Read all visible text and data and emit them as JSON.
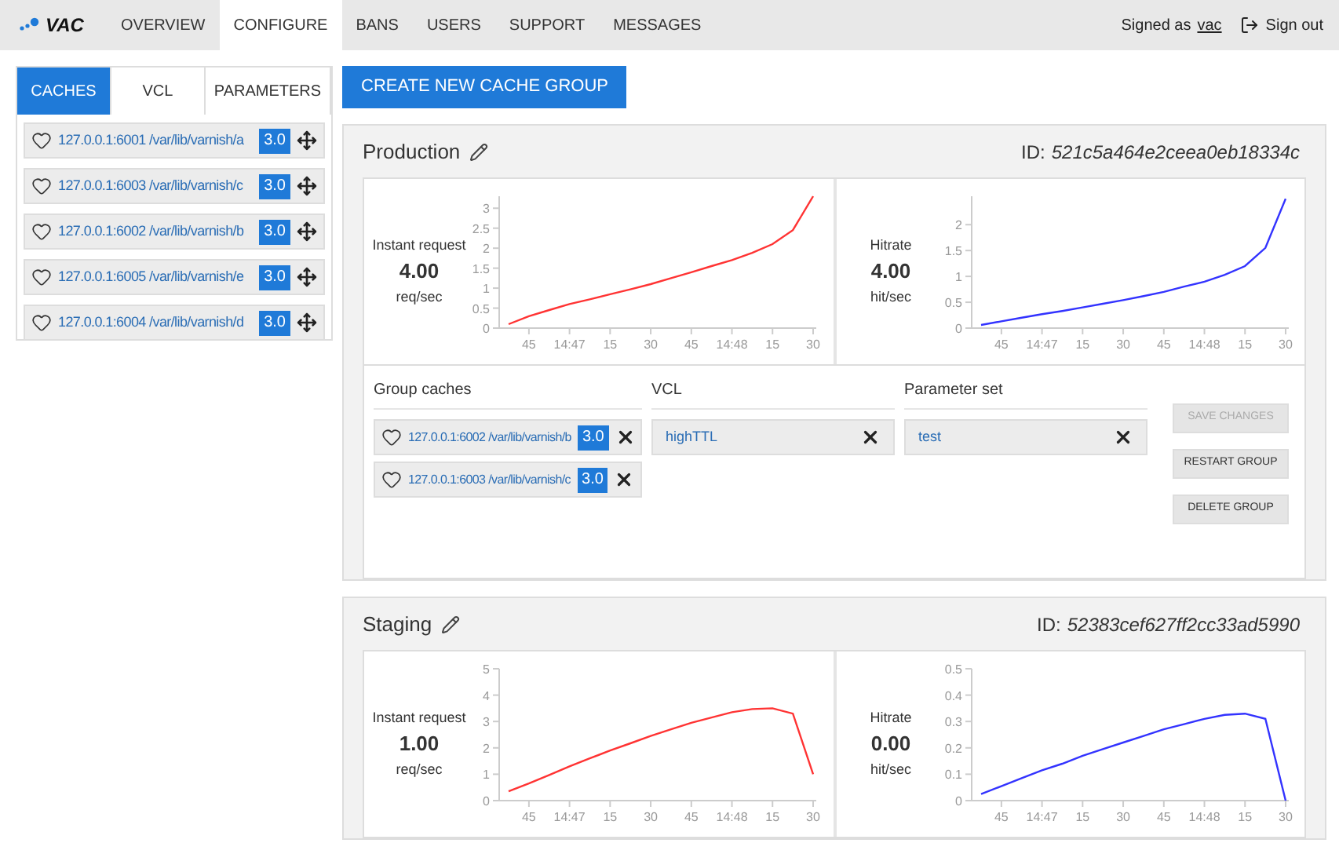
{
  "header": {
    "logo": "VAC",
    "nav": [
      {
        "label": "OVERVIEW",
        "selected": false
      },
      {
        "label": "CONFIGURE",
        "selected": true
      },
      {
        "label": "BANS",
        "selected": false
      },
      {
        "label": "USERS",
        "selected": false
      },
      {
        "label": "SUPPORT",
        "selected": false
      },
      {
        "label": "MESSAGES",
        "selected": false
      }
    ],
    "signed_as": "Signed as",
    "user": "vac",
    "sign_out": "Sign out"
  },
  "sidebar": {
    "tabs": [
      {
        "label": "CACHES",
        "selected": true
      },
      {
        "label": "VCL",
        "selected": false
      },
      {
        "label": "PARAMETERS",
        "selected": false
      }
    ],
    "caches": [
      {
        "address": "127.0.0.1:6001 /var/lib/varnish/a",
        "version": "3.0"
      },
      {
        "address": "127.0.0.1:6003 /var/lib/varnish/c",
        "version": "3.0"
      },
      {
        "address": "127.0.0.1:6002 /var/lib/varnish/b",
        "version": "3.0"
      },
      {
        "address": "127.0.0.1:6005 /var/lib/varnish/e",
        "version": "3.0"
      },
      {
        "address": "127.0.0.1:6004 /var/lib/varnish/d",
        "version": "3.0"
      }
    ]
  },
  "create_button": "CREATE NEW CACHE GROUP",
  "groups": [
    {
      "name": "Production",
      "id_label": "ID:",
      "id": "521c5a464e2ceea0eb18334c",
      "metrics": [
        {
          "label": "Instant request",
          "value": "4.00",
          "unit": "req/sec",
          "chart_data": {
            "type": "line",
            "ylim": [
              0,
              3.3
            ],
            "yticks": [
              0,
              0.5,
              1,
              1.5,
              2,
              2.5,
              3
            ],
            "categories": [
              null,
              "45",
              null,
              "14:47",
              null,
              "15",
              null,
              "30",
              null,
              "45",
              null,
              "14:48",
              null,
              "15",
              null,
              "30"
            ],
            "series": [
              {
                "color": "#ff3333",
                "values": [
                  0.1,
                  0.3,
                  0.45,
                  0.6,
                  0.72,
                  0.85,
                  0.97,
                  1.1,
                  1.25,
                  1.4,
                  1.55,
                  1.7,
                  1.88,
                  2.1,
                  2.45,
                  3.3
                ]
              }
            ]
          }
        },
        {
          "label": "Hitrate",
          "value": "4.00",
          "unit": "hit/sec",
          "chart_data": {
            "type": "line",
            "ylim": [
              0,
              2.55
            ],
            "yticks": [
              0,
              0.5,
              1,
              1.5,
              2
            ],
            "categories": [
              null,
              "45",
              null,
              "14:47",
              null,
              "15",
              null,
              "30",
              null,
              "45",
              null,
              "14:48",
              null,
              "15",
              null,
              "30"
            ],
            "series": [
              {
                "color": "#3333ff",
                "values": [
                  0.06,
                  0.13,
                  0.2,
                  0.27,
                  0.33,
                  0.4,
                  0.47,
                  0.54,
                  0.62,
                  0.7,
                  0.8,
                  0.9,
                  1.03,
                  1.2,
                  1.55,
                  2.5
                ]
              }
            ]
          }
        }
      ],
      "caches_heading": "Group caches",
      "caches": [
        {
          "address": "127.0.0.1:6002 /var/lib/varnish/b",
          "version": "3.0"
        },
        {
          "address": "127.0.0.1:6003 /var/lib/varnish/c",
          "version": "3.0"
        }
      ],
      "vcl_heading": "VCL",
      "vcl": "highTTL",
      "params_heading": "Parameter set",
      "params": "test",
      "actions": [
        {
          "label": "SAVE CHANGES",
          "disabled": true
        },
        {
          "label": "RESTART GROUP",
          "disabled": false
        },
        {
          "label": "DELETE GROUP",
          "disabled": false
        }
      ]
    },
    {
      "name": "Staging",
      "id_label": "ID:",
      "id": "52383cef627ff2cc33ad5990",
      "metrics": [
        {
          "label": "Instant request",
          "value": "1.00",
          "unit": "req/sec",
          "chart_data": {
            "type": "line",
            "ylim": [
              0,
              5
            ],
            "yticks": [
              0,
              1,
              2,
              3,
              4,
              5
            ],
            "categories": [
              null,
              "45",
              null,
              "14:47",
              null,
              "15",
              null,
              "30",
              null,
              "45",
              null,
              "14:48",
              null,
              "15",
              null,
              "30"
            ],
            "series": [
              {
                "color": "#ff3333",
                "values": [
                  0.35,
                  0.65,
                  0.97,
                  1.3,
                  1.6,
                  1.9,
                  2.17,
                  2.45,
                  2.7,
                  2.95,
                  3.15,
                  3.35,
                  3.47,
                  3.5,
                  3.3,
                  1.0
                ]
              }
            ]
          }
        },
        {
          "label": "Hitrate",
          "value": "0.00",
          "unit": "hit/sec",
          "chart_data": {
            "type": "line",
            "ylim": [
              0,
              0.5
            ],
            "yticks": [
              0,
              0.1,
              0.2,
              0.3,
              0.4,
              0.5
            ],
            "categories": [
              null,
              "45",
              null,
              "14:47",
              null,
              "15",
              null,
              "30",
              null,
              "45",
              null,
              "14:48",
              null,
              "15",
              null,
              "30"
            ],
            "series": [
              {
                "color": "#3333ff",
                "values": [
                  0.025,
                  0.055,
                  0.085,
                  0.115,
                  0.14,
                  0.17,
                  0.195,
                  0.22,
                  0.245,
                  0.27,
                  0.29,
                  0.31,
                  0.325,
                  0.33,
                  0.31,
                  0.0
                ]
              }
            ]
          }
        }
      ]
    }
  ]
}
